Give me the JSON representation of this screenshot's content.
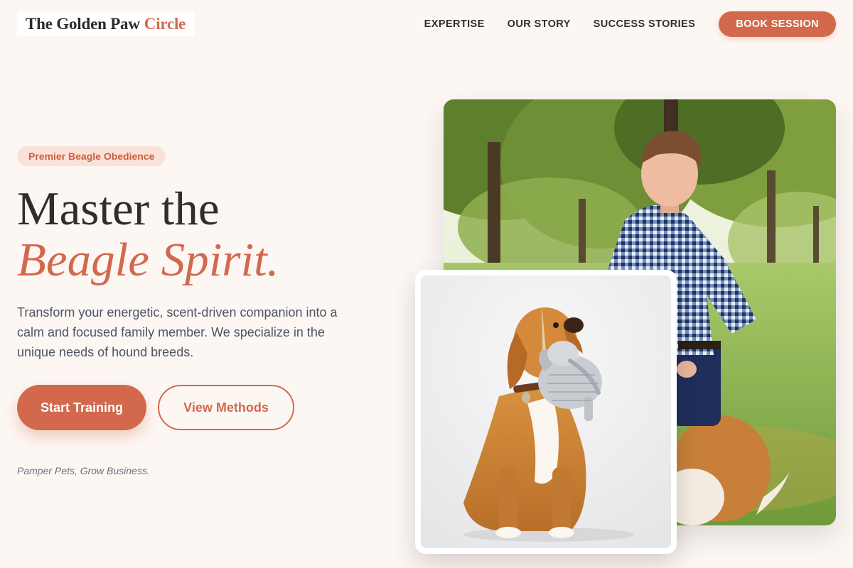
{
  "brand": {
    "name_main": "The Golden Paw",
    "name_accent": "Circle",
    "accent_color": "#d2694d"
  },
  "nav": {
    "links": [
      "EXPERTISE",
      "OUR STORY",
      "SUCCESS STORIES"
    ],
    "cta": "BOOK SESSION"
  },
  "hero": {
    "badge": "Premier Beagle Obedience",
    "headline_line1": "Master the",
    "headline_line2": "Beagle Spirit.",
    "description": "Transform your energetic, scent-driven companion into a calm and focused family member. We specialize in the unique needs of hound breeds.",
    "primary_button": "Start Training",
    "secondary_button": "View Methods",
    "tagline": "Pamper Pets, Grow Business."
  },
  "images": {
    "main": "photo of a young man in a blue gingham shirt kneeling with a dog in a sunlit park",
    "card": "photo of a golden retriever sitting and holding a striped plush elephant toy"
  },
  "colors": {
    "background": "#fdf7f4",
    "accent": "#d2694d",
    "badge_bg": "#fbe2d8",
    "text_dark": "#2e2e2e",
    "text_muted": "#4b5563"
  }
}
